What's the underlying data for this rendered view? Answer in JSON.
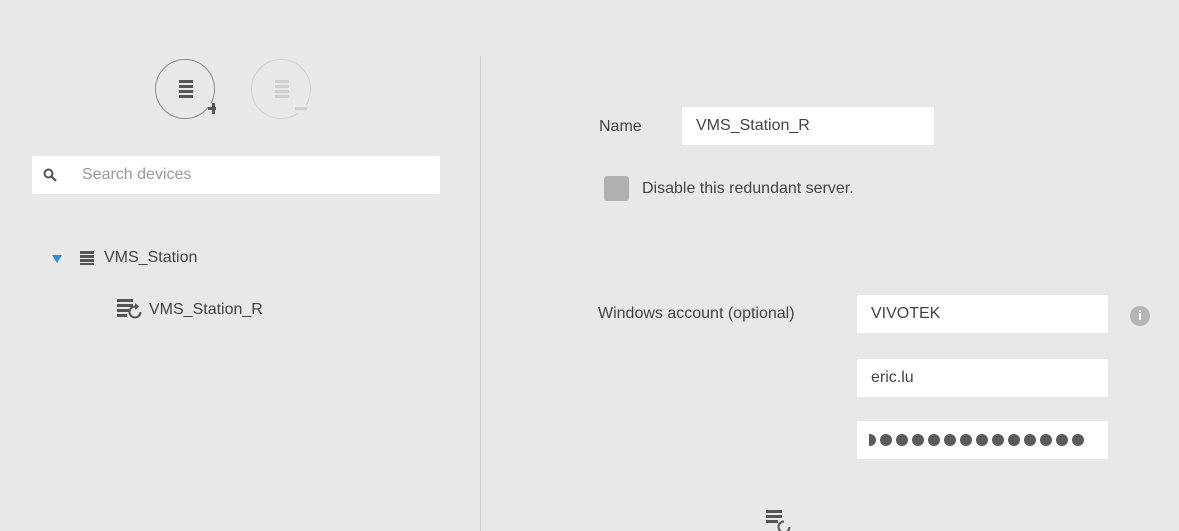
{
  "toolbar": {
    "add_icon": "server-add-icon",
    "remove_icon": "server-remove-icon"
  },
  "search": {
    "placeholder": "Search devices",
    "icon": "search-icon"
  },
  "tree": {
    "root": {
      "label": "VMS_Station",
      "icon": "server-icon",
      "expanded": true
    },
    "child": {
      "label": "VMS_Station_R",
      "icon": "redundant-server-icon"
    }
  },
  "form": {
    "name_label": "Name",
    "name_value": "VMS_Station_R",
    "disable_label": "Disable this redundant server.",
    "windows_account_label": "Windows account (optional)",
    "domain_value": "VIVOTEK",
    "username_value": "eric.lu",
    "password_dot_count": 14
  },
  "colors": {
    "background": "#e8e8e8",
    "expand_arrow": "#2a8fd6",
    "field_bg": "#ffffff"
  }
}
